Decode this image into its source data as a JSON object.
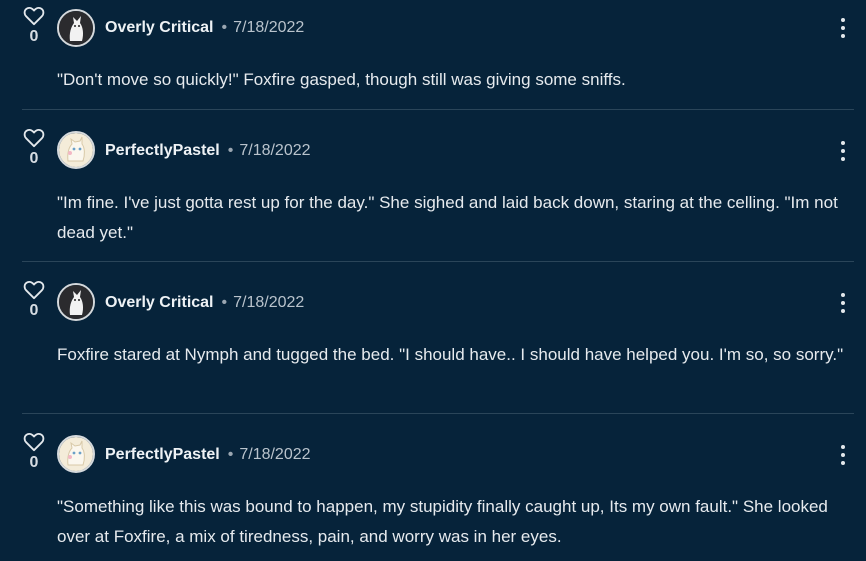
{
  "colors": {
    "background": "#06233a",
    "text": "#e6eaee",
    "divider": "#2a4559"
  },
  "comments": [
    {
      "likes": "0",
      "author": "Overly Critical",
      "separator": "•",
      "date": "7/18/2022",
      "text": "\"Don't move so quickly!\" Foxfire gasped, though still was giving some sniffs.",
      "avatar_icon": "white-fox-avatar-icon"
    },
    {
      "likes": "0",
      "author": "PerfectlyPastel",
      "separator": "•",
      "date": "7/18/2022",
      "text": "\"Im fine. I've just gotta rest up for the day.\" She sighed and laid back down, staring at the celling. \"Im not dead yet.\"",
      "avatar_icon": "pastel-cat-avatar-icon"
    },
    {
      "likes": "0",
      "author": "Overly Critical",
      "separator": "•",
      "date": "7/18/2022",
      "text": "Foxfire stared at Nymph and tugged the bed. \"I should have.. I should have helped you. I'm so, so sorry.\"",
      "avatar_icon": "white-fox-avatar-icon"
    },
    {
      "likes": "0",
      "author": "PerfectlyPastel",
      "separator": "•",
      "date": "7/18/2022",
      "text": "\"Something like this was bound to happen, my stupidity finally caught up, Its my own fault.\" She looked over at Foxfire, a mix of tiredness, pain, and worry was in her eyes.",
      "avatar_icon": "pastel-cat-avatar-icon"
    }
  ]
}
